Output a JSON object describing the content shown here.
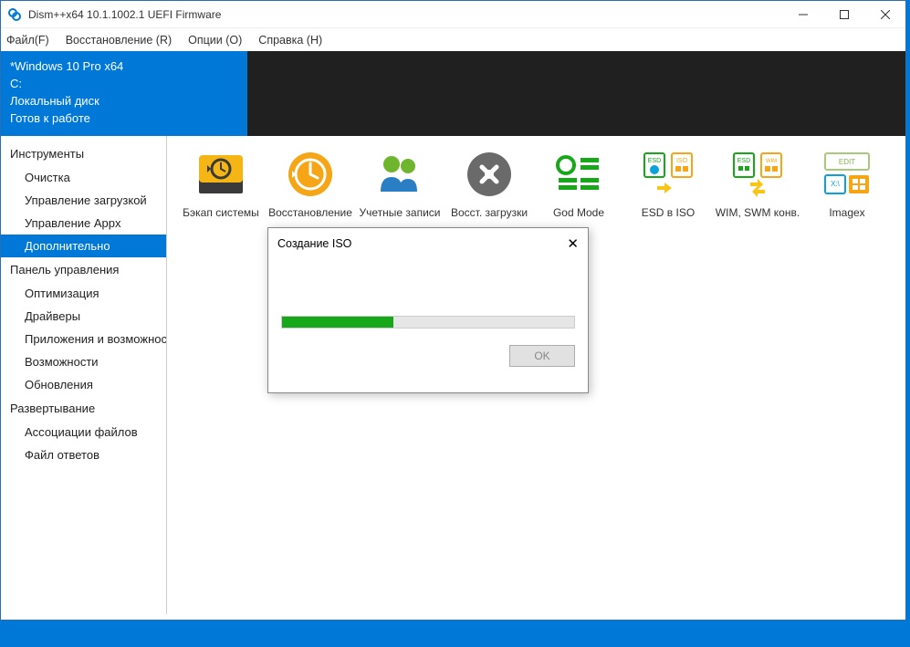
{
  "titlebar": {
    "title": "Dism++x64 10.1.1002.1 UEFI Firmware"
  },
  "menu": {
    "file": "Файл(F)",
    "recover": "Восстановление (R)",
    "options": "Опции (O)",
    "help": "Справка (H)"
  },
  "info": {
    "line1": "*Windows 10 Pro x64",
    "line2": "C:",
    "line3": "Локальный диск",
    "line4": "Готов к работе"
  },
  "sidebar": {
    "group1_head": "Инструменты",
    "group1": {
      "i0": "Очистка",
      "i1": "Управление загрузкой",
      "i2": "Управление Appx",
      "i3": "Дополнительно"
    },
    "group2_head": "Панель управления",
    "group2": {
      "i0": "Оптимизация",
      "i1": "Драйверы",
      "i2": "Приложения и возможности",
      "i3": "Возможности",
      "i4": "Обновления"
    },
    "group3_head": "Развертывание",
    "group3": {
      "i0": "Ассоциации файлов",
      "i1": "Файл ответов"
    }
  },
  "tools": {
    "t0": "Бэкап системы",
    "t1": "Восстановление",
    "t2": "Учетные записи",
    "t3": "Восст. загрузки",
    "t4": "God Mode",
    "t5": "ESD в ISO",
    "t6": "WIM, SWM конв.",
    "t7": "Imagex"
  },
  "dialog": {
    "title": "Создание ISO",
    "ok": "OK",
    "progress_pct": 38
  }
}
